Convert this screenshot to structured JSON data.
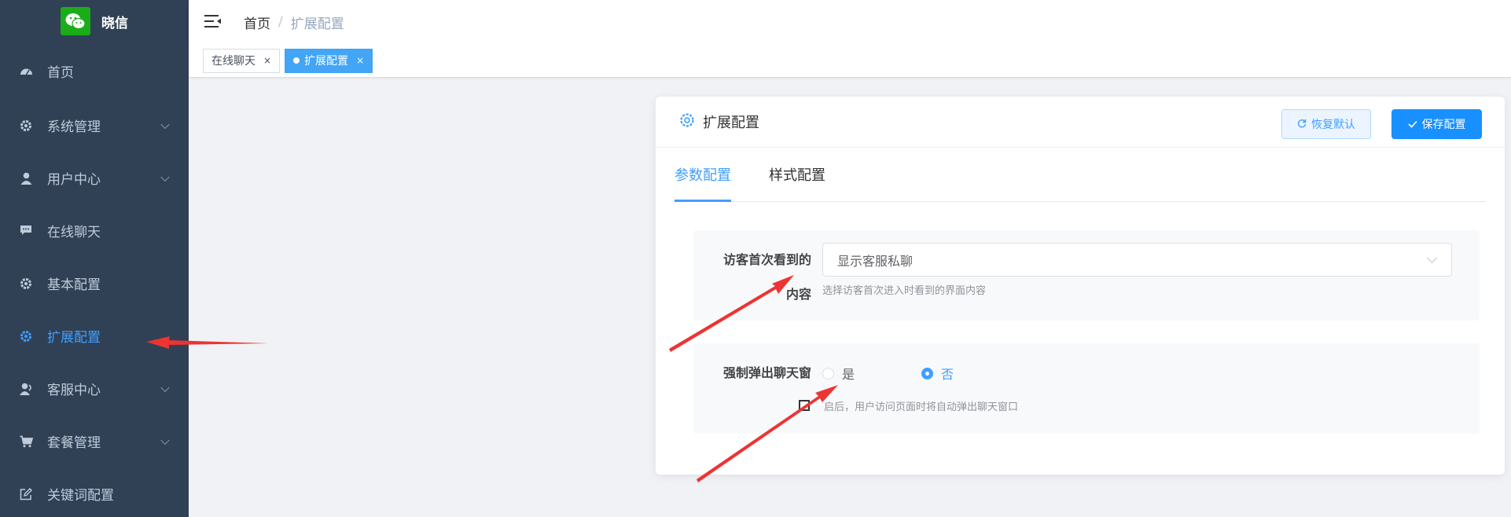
{
  "app": {
    "name": "晓信",
    "logo_icon": "wechat-icon",
    "brand_color": "#1aad19"
  },
  "sidebar": {
    "items": [
      {
        "label": "首页",
        "icon": "dashboard-icon",
        "has_children": false,
        "active": false
      },
      {
        "label": "系统管理",
        "icon": "gear-icon",
        "has_children": true,
        "active": false
      },
      {
        "label": "用户中心",
        "icon": "user-icon",
        "has_children": true,
        "active": false
      },
      {
        "label": "在线聊天",
        "icon": "chat-icon",
        "has_children": false,
        "active": false
      },
      {
        "label": "基本配置",
        "icon": "gear-icon",
        "has_children": false,
        "active": false
      },
      {
        "label": "扩展配置",
        "icon": "gear-icon",
        "has_children": false,
        "active": true
      },
      {
        "label": "客服中心",
        "icon": "agent-icon",
        "has_children": true,
        "active": false
      },
      {
        "label": "套餐管理",
        "icon": "cart-icon",
        "has_children": true,
        "active": false
      },
      {
        "label": "关键词配置",
        "icon": "edit-icon",
        "has_children": false,
        "active": false
      }
    ]
  },
  "header": {
    "breadcrumb": {
      "home": "首页",
      "separator": "/",
      "current": "扩展配置"
    }
  },
  "tags": [
    {
      "label": "在线聊天",
      "active": false,
      "close": "×"
    },
    {
      "label": "扩展配置",
      "active": true,
      "close": "×"
    }
  ],
  "card": {
    "title": "扩展配置",
    "title_icon": "gear-outline-icon",
    "reset_label": "恢复默认",
    "save_label": "保存配置",
    "tabs": [
      {
        "label": "参数配置",
        "active": true
      },
      {
        "label": "样式配置",
        "active": false
      }
    ],
    "fields": {
      "first_view": {
        "label_line1": "访客首次看到的",
        "label_line2": "内容",
        "value": "显示客服私聊",
        "hint": "选择访客首次进入时看到的界面内容"
      },
      "force_popup": {
        "label": "强制弹出聊天窗",
        "options": [
          {
            "label": "是",
            "checked": false
          },
          {
            "label": "否",
            "checked": true
          }
        ],
        "hint": "启后，用户访问页面时将自动弹出聊天窗口"
      }
    }
  },
  "colors": {
    "sidebar_bg": "#304156",
    "accent": "#409eff",
    "annotation_arrow": "#ee3333"
  }
}
